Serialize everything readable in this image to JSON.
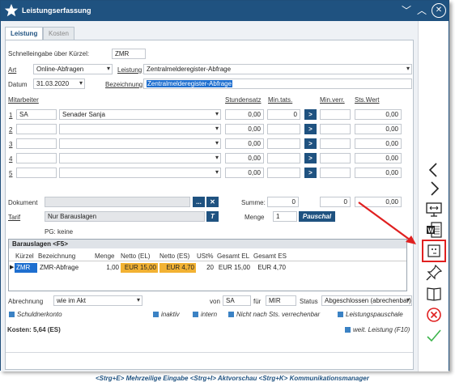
{
  "window": {
    "title": "Leistungserfassung"
  },
  "tabs": [
    "Leistung",
    "Kosten"
  ],
  "quick_entry": {
    "label": "Schnelleingabe über Kürzel:",
    "value": "ZMR"
  },
  "art": {
    "label": "Art",
    "value": "Online-Abfragen"
  },
  "leistung": {
    "label": "Leistung",
    "value": "Zentralmelderegister-Abfrage"
  },
  "datum": {
    "label": "Datum",
    "value": "31.03.2020"
  },
  "bezeichnung": {
    "label": "Bezeichnung",
    "value": "Zentralmelderegister-Abfrage"
  },
  "col_headers": {
    "mitarbeiter": "Mitarbeiter",
    "stundensatz": "Stundensatz",
    "min_tats": "Min.tats.",
    "min_verr": "Min.verr.",
    "sts_wert": "Sts.Wert"
  },
  "rows": [
    {
      "num": "1",
      "kurz": "SA",
      "name": "Senader Sanja",
      "rate": "0,00",
      "min": "0",
      "btn": ">",
      "wert": "0,00"
    },
    {
      "num": "2",
      "kurz": "",
      "name": "",
      "rate": "0,00",
      "min": "",
      "btn": ">",
      "wert": "0,00"
    },
    {
      "num": "3",
      "kurz": "",
      "name": "",
      "rate": "0,00",
      "min": "",
      "btn": ">",
      "wert": "0,00"
    },
    {
      "num": "4",
      "kurz": "",
      "name": "",
      "rate": "0,00",
      "min": "",
      "btn": ">",
      "wert": "0,00"
    },
    {
      "num": "5",
      "kurz": "",
      "name": "",
      "rate": "0,00",
      "min": "",
      "btn": ">",
      "wert": "0,00"
    }
  ],
  "dokument": {
    "label": "Dokument",
    "btn": "...",
    "close": "✕"
  },
  "summe": {
    "label": "Summe:",
    "min": "0",
    "verr": "0",
    "wert": "0,00"
  },
  "tarif": {
    "label": "Tarif",
    "value": "Nur Barauslagen",
    "btn": "T"
  },
  "menge": {
    "label": "Menge",
    "value": "1",
    "pauschal": "Pauschal"
  },
  "pg": "PG: keine",
  "barauslagen": {
    "title": "Barauslagen <F5>",
    "columns": [
      "Kürzel",
      "Bezeichnung",
      "Menge",
      "Netto (EL)",
      "Netto (ES)",
      "USt%",
      "Gesamt EL",
      "Gesamt ES"
    ],
    "row": [
      "ZMR",
      "ZMR-Abfrage",
      "1,00",
      "EUR 15,00",
      "EUR 4,70",
      "20",
      "EUR 15,00",
      "EUR 4,70"
    ]
  },
  "abrechnung": {
    "label": "Abrechnung",
    "value": "wie im Akt"
  },
  "von": {
    "label": "von",
    "value": "SA"
  },
  "fuer": {
    "label": "für",
    "value": "MIR"
  },
  "status": {
    "label": "Status",
    "value": "Abgeschlossen (abrechenbar)"
  },
  "checkboxes": {
    "schuldnerkonto": "Schuldnerkonto",
    "inaktiv": "inaktiv",
    "intern": "intern",
    "nicht_sts": "Nicht nach Sts. verrechenbar",
    "pauschale": "Leistungspauschale",
    "weit": "weit. Leistung (F10)"
  },
  "kosten": "Kosten: 5,64 (ES)",
  "footer": "<Strg+E> Mehrzeilige Eingabe <Strg+I> Aktvorschau <Strg+K> Kommunikationsmanager",
  "colors": {
    "title_bar": "#1f5280",
    "accent": "#1e6fd0",
    "highlight_orange": "#f2b233",
    "arrow": "#e02020"
  }
}
